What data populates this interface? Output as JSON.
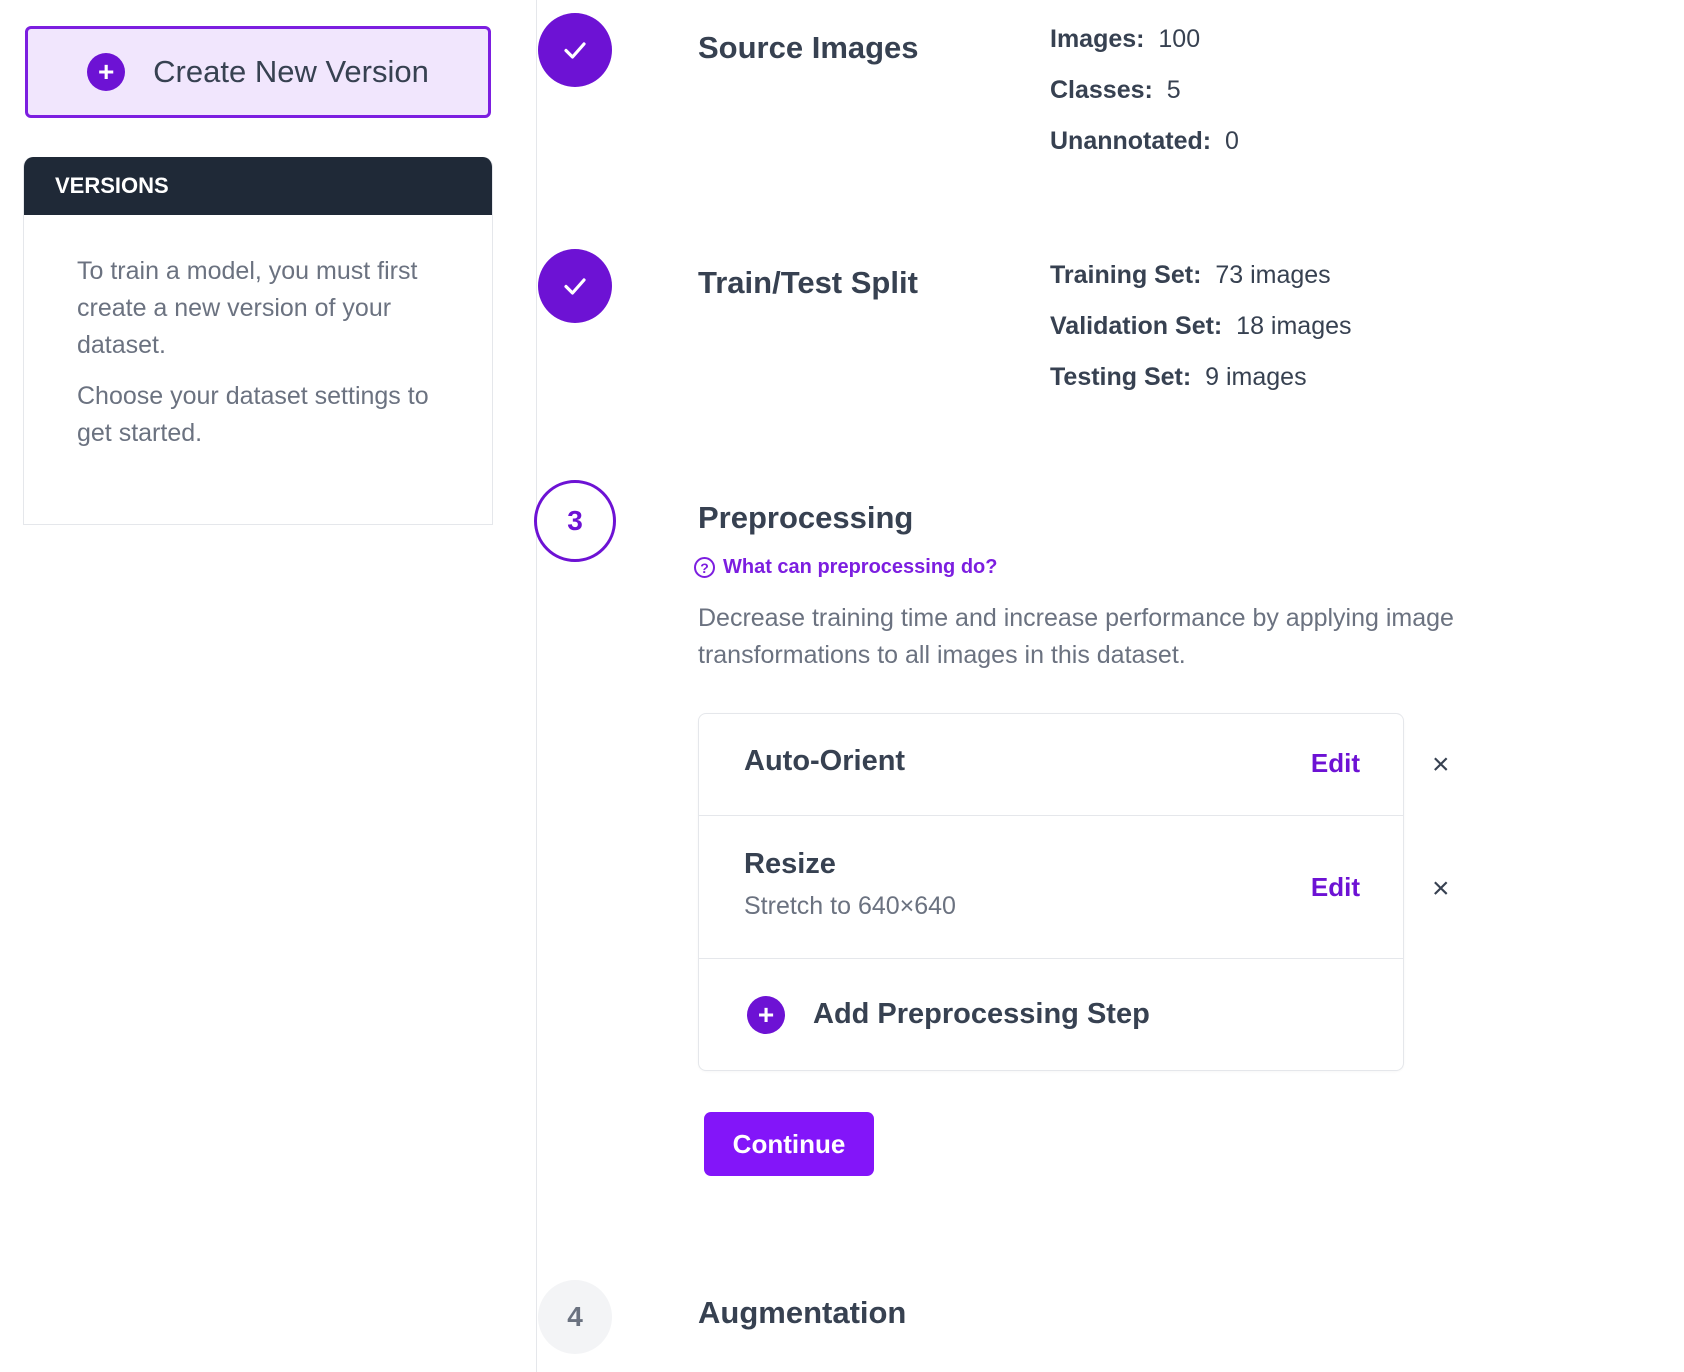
{
  "sidebar": {
    "create_button": {
      "label": "Create New Version",
      "icon": "plus-circle-icon"
    },
    "versions": {
      "header": "VERSIONS",
      "paragraphs": [
        "To train a model, you must first create a new version of your dataset.",
        "Choose your dataset settings to get started."
      ]
    }
  },
  "steps": {
    "source_images": {
      "title": "Source Images",
      "status": "completed",
      "stats": [
        {
          "key": "Images:",
          "value": "100"
        },
        {
          "key": "Classes:",
          "value": "5"
        },
        {
          "key": "Unannotated:",
          "value": "0"
        }
      ]
    },
    "split": {
      "title": "Train/Test Split",
      "status": "completed",
      "stats": [
        {
          "key": "Training Set:",
          "value": "73 images"
        },
        {
          "key": "Validation Set:",
          "value": "18 images"
        },
        {
          "key": "Testing Set:",
          "value": "9 images"
        }
      ]
    },
    "preprocessing": {
      "number": "3",
      "title": "Preprocessing",
      "status": "active",
      "help_link": "What can preprocessing do?",
      "description": "Decrease training time and increase performance by applying image transformations to all images in this dataset.",
      "items": [
        {
          "name": "Auto-Orient",
          "detail": "",
          "edit": "Edit",
          "remove": "×"
        },
        {
          "name": "Resize",
          "detail": "Stretch to 640×640",
          "edit": "Edit",
          "remove": "×"
        }
      ],
      "add_step": "Add Preprocessing Step",
      "continue": "Continue"
    },
    "augmentation": {
      "number": "4",
      "title": "Augmentation",
      "status": "pending"
    }
  },
  "colors": {
    "accent": "#6d12d4",
    "button": "#8315f9",
    "header_dark": "#1f2937",
    "create_bg": "#f1e6fd"
  }
}
